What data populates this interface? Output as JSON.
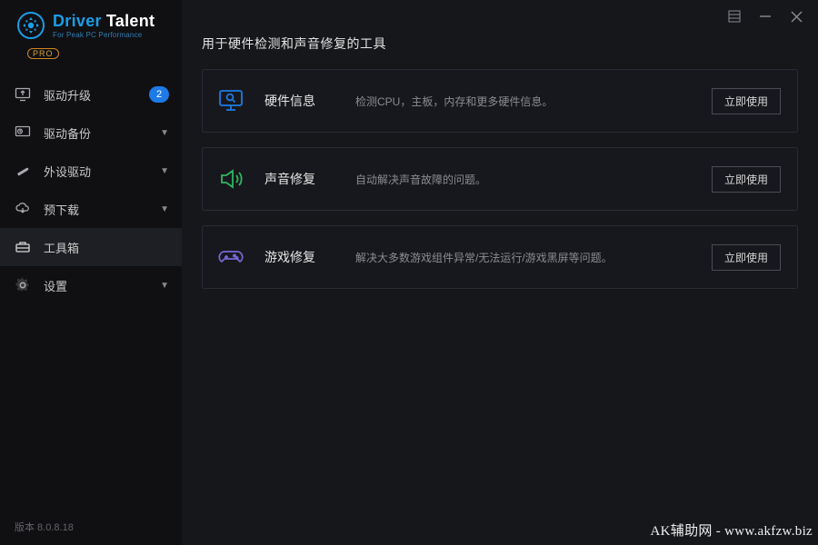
{
  "brand": {
    "word1": "Driver",
    "word2": "Talent",
    "word1_color": "#1a9ee6",
    "word2_color": "#ffffff",
    "subtitle": "For Peak PC Performance",
    "pro": "PRO"
  },
  "sidebar": {
    "items": [
      {
        "label": "驱动升级",
        "badge": "2",
        "caret": false
      },
      {
        "label": "驱动备份",
        "badge": null,
        "caret": true
      },
      {
        "label": "外设驱动",
        "badge": null,
        "caret": true
      },
      {
        "label": "预下载",
        "badge": null,
        "caret": true
      },
      {
        "label": "工具箱",
        "badge": null,
        "caret": false
      },
      {
        "label": "设置",
        "badge": null,
        "caret": true
      }
    ],
    "active_index": 4
  },
  "version": "版本 8.0.8.18",
  "page": {
    "title": "用于硬件检测和声音修复的工具",
    "tools": [
      {
        "title": "硬件信息",
        "desc": "检测CPU，主板，内存和更多硬件信息。",
        "btn": "立即使用",
        "icon_color": "#1d7ae6"
      },
      {
        "title": "声音修复",
        "desc": "自动解决声音故障的问题。",
        "btn": "立即使用",
        "icon_color": "#2fb760"
      },
      {
        "title": "游戏修复",
        "desc": "解决大多数游戏组件异常/无法运行/游戏黑屏等问题。",
        "btn": "立即使用",
        "icon_color": "#7965d6"
      }
    ]
  },
  "watermark": "AK辅助网 - www.akfzw.biz"
}
